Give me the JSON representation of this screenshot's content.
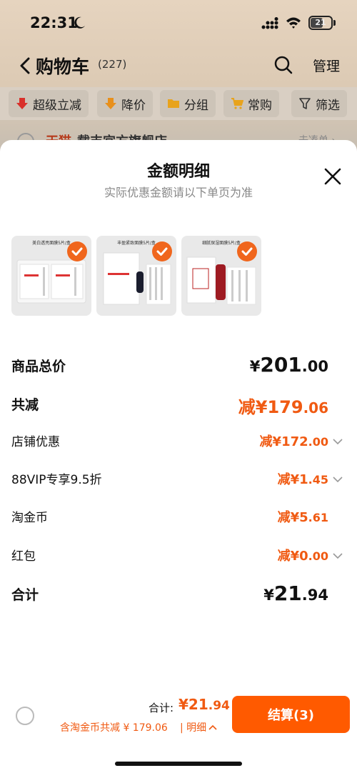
{
  "status_bar": {
    "time": "22:31",
    "battery": "21"
  },
  "nav": {
    "title": "购物车",
    "count": "(227)",
    "manage": "管理"
  },
  "filters": [
    {
      "label": "超级立减",
      "icon": "down-arrow-red"
    },
    {
      "label": "降价",
      "icon": "down-arrow-orange"
    },
    {
      "label": "分组",
      "icon": "folder"
    },
    {
      "label": "常购",
      "icon": "cart"
    },
    {
      "label": "筛选",
      "icon": "filter"
    }
  ],
  "peek": {
    "tag": "天猫",
    "store": "载丰宜方旗舰店",
    "right": "去凑单 ›"
  },
  "sheet": {
    "title": "金额明细",
    "subtitle": "实际优惠金额请以下单页为准",
    "thumbs": [
      {
        "caption": "美白透亮面膜5片/盒"
      },
      {
        "caption": "丰盈紧致面膜5片/盒"
      },
      {
        "caption": "细腻保湿面膜5片/盒"
      }
    ],
    "rows": {
      "subtotal": {
        "label": "商品总价",
        "yen": "¥",
        "int": "201",
        "cents": ".00"
      },
      "total_discount": {
        "label": "共减",
        "prefix": "减¥",
        "int": "179",
        "cents": ".06"
      },
      "store_discount": {
        "label": "店铺优惠",
        "prefix": "减¥",
        "int": "172",
        "cents": ".00"
      },
      "vip_discount": {
        "label": "88VIP专享9.5折",
        "prefix": "减¥",
        "int": "1",
        "cents": ".45"
      },
      "coin_discount": {
        "label": "淘金币",
        "prefix": "减¥",
        "int": "5",
        "cents": ".61"
      },
      "red_packet": {
        "label": "红包",
        "prefix": "减¥",
        "int": "0",
        "cents": ".00"
      },
      "grand_total": {
        "label": "合计",
        "yen": "¥",
        "int": "21",
        "cents": ".94"
      }
    }
  },
  "footer": {
    "total_label": "合计:",
    "total_prefix": "¥",
    "total_int": "21",
    "total_cents": ".94",
    "coin_note": "含淘金币共减 ¥ 179.06",
    "detail_link": "| 明细",
    "checkout": "结算(3)"
  },
  "colors": {
    "accent": "#ff5a00",
    "discount_text": "#f05a12"
  }
}
